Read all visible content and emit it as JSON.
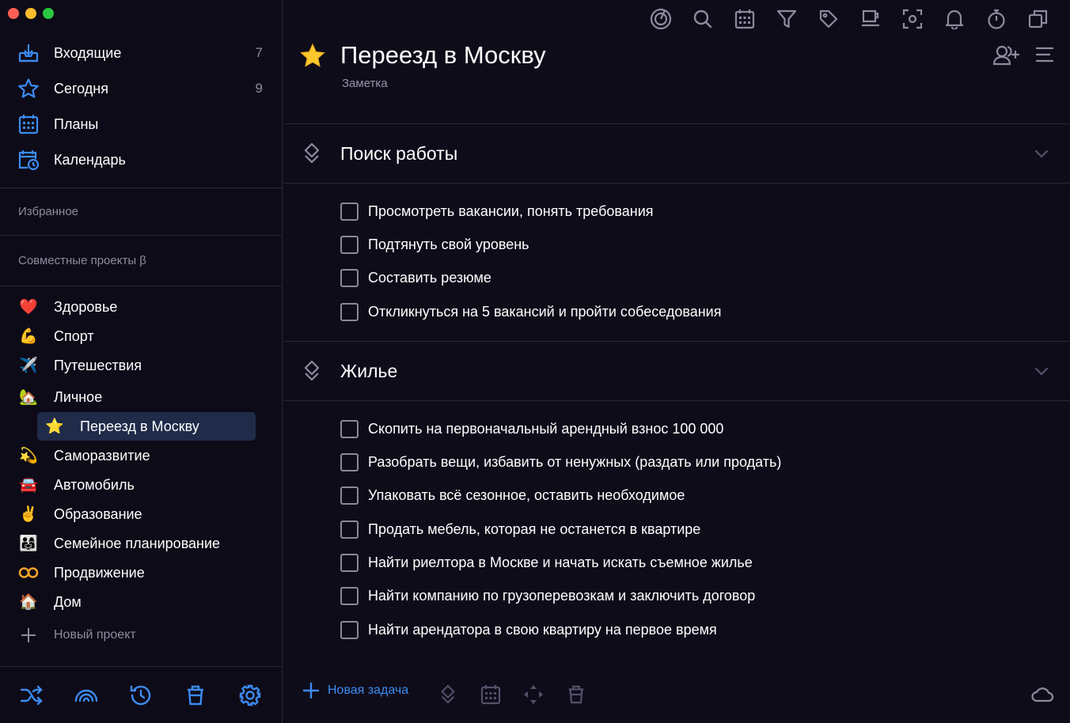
{
  "sidebar": {
    "nav": [
      {
        "label": "Входящие",
        "count": "7",
        "icon": "inbox-icon"
      },
      {
        "label": "Сегодня",
        "count": "9",
        "icon": "star-outline-icon"
      },
      {
        "label": "Планы",
        "count": "",
        "icon": "calendar-grid-icon"
      },
      {
        "label": "Календарь",
        "count": "",
        "icon": "calendar-clock-icon"
      }
    ],
    "favorites_label": "Избранное",
    "shared_label": "Совместные проекты β",
    "projects": [
      {
        "emoji": "❤️",
        "label": "Здоровье"
      },
      {
        "emoji": "💪",
        "label": "Спорт"
      },
      {
        "emoji": "✈️",
        "label": "Путешествия"
      },
      {
        "emoji": "🏡",
        "label": "Личное"
      },
      {
        "emoji": "⭐",
        "label": "Переезд в Москву"
      },
      {
        "emoji": "💫",
        "label": "Саморазвитие"
      },
      {
        "emoji": "🚘",
        "label": "Автомобиль"
      },
      {
        "emoji": "✌️",
        "label": "Образование"
      },
      {
        "emoji": "👨‍👩‍👧",
        "label": "Семейное планирование"
      },
      {
        "emoji": "∞",
        "label": "Продвижение"
      },
      {
        "emoji": "🏠",
        "label": "Дом"
      }
    ],
    "new_project_label": "Новый проект"
  },
  "project": {
    "title": "Переезд в Москву",
    "subtitle": "Заметка"
  },
  "sections": [
    {
      "title": "Поиск работы",
      "tasks": [
        "Просмотреть вакансии, понять требования",
        "Подтянуть свой уровень",
        "Составить резюме",
        "Откликнуться на 5 вакансий и пройти собеседования"
      ]
    },
    {
      "title": "Жилье",
      "tasks": [
        "Скопить на первоначальный арендный взнос 100 000",
        "Разобрать вещи, избавить от ненужных (раздать или продать)",
        "Упаковать всё сезонное, оставить необходимое",
        "Продать мебель, которая не останется в квартире",
        "Найти риелтора в Москве и начать искать съемное жилье",
        "Найти компанию по грузоперевозкам и заключить договор",
        "Найти арендатора в свою квартиру на первое время"
      ]
    }
  ],
  "footer": {
    "new_task_label": "Новая задача"
  },
  "colors": {
    "accent": "#3c8cf2",
    "background": "#0f0c1a",
    "active_project": "#1f2b49"
  }
}
